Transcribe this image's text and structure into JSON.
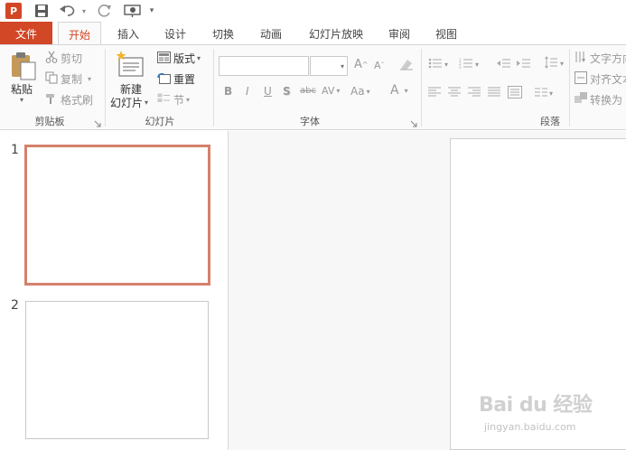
{
  "qat": {
    "app_logo": "P",
    "icons": [
      "powerpoint-logo",
      "save-icon",
      "undo-icon",
      "redo-icon",
      "start-from-beginning-icon",
      "customize-qat-icon"
    ]
  },
  "tabs": {
    "file": "文件",
    "home": "开始",
    "insert": "插入",
    "design": "设计",
    "transitions": "切换",
    "animations": "动画",
    "slideshow": "幻灯片放映",
    "review": "审阅",
    "view": "视图"
  },
  "ribbon": {
    "clipboard": {
      "paste": "粘贴",
      "cut": "剪切",
      "copy": "复制",
      "format_painter": "格式刷",
      "group_label": "剪贴板"
    },
    "slides": {
      "new_slide_line1": "新建",
      "new_slide_line2": "幻灯片",
      "layout": "版式",
      "reset": "重置",
      "section": "节",
      "group_label": "幻灯片"
    },
    "font": {
      "font_name": "",
      "font_size": "",
      "bold": "B",
      "italic": "I",
      "underline": "U",
      "shadow": "S",
      "strikethrough": "abc",
      "char_spacing": "AV",
      "change_case": "Aa",
      "font_color": "A",
      "grow": "A",
      "shrink": "A",
      "group_label": "字体"
    },
    "paragraph": {
      "text_direction": "文字方向",
      "align_text": "对齐文本",
      "convert_smartart": "转换为",
      "group_label": "段落"
    }
  },
  "slides_panel": {
    "slides": [
      {
        "number": "1",
        "selected": true
      },
      {
        "number": "2",
        "selected": false
      }
    ]
  },
  "watermark": {
    "logo": "Bai du 经验",
    "url": "jingyan.baidu.com"
  },
  "colors": {
    "accent": "#d24726",
    "selected_thumb_border": "#d5806c",
    "ribbon_bg": "#fafafa",
    "edit_bg": "#f8f7f8"
  }
}
